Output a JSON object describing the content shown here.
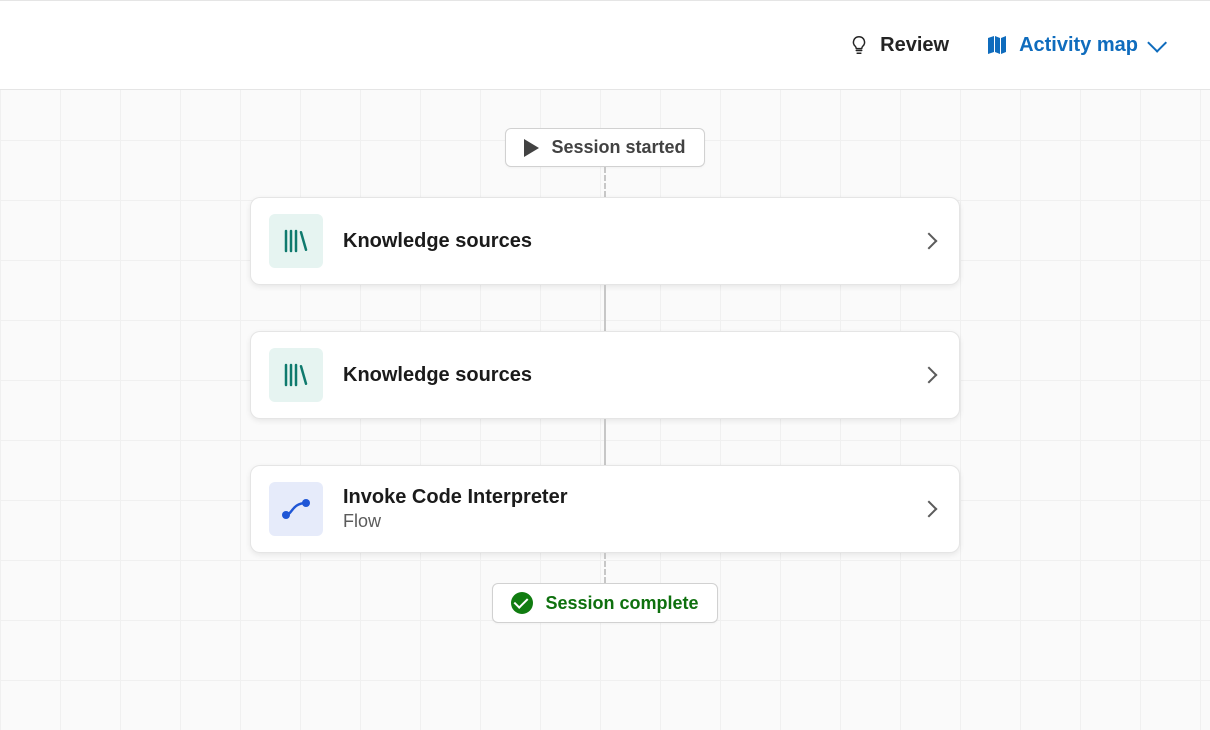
{
  "toolbar": {
    "review_label": "Review",
    "activity_map_label": "Activity map"
  },
  "flow": {
    "start_label": "Session started",
    "complete_label": "Session complete",
    "nodes": [
      {
        "title": "Knowledge sources",
        "subtitle": "",
        "icon": "books-icon",
        "tile": "teal"
      },
      {
        "title": "Knowledge sources",
        "subtitle": "",
        "icon": "books-icon",
        "tile": "teal"
      },
      {
        "title": "Invoke Code Interpreter",
        "subtitle": "Flow",
        "icon": "flow-icon",
        "tile": "blue"
      }
    ]
  }
}
